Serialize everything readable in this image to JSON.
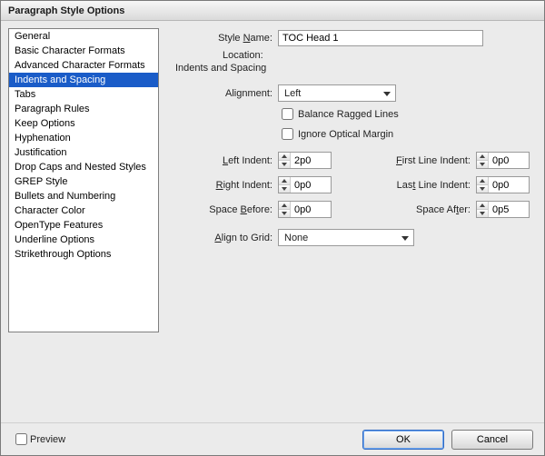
{
  "window": {
    "title": "Paragraph Style Options"
  },
  "sidebar": {
    "items": [
      "General",
      "Basic Character Formats",
      "Advanced Character Formats",
      "Indents and Spacing",
      "Tabs",
      "Paragraph Rules",
      "Keep Options",
      "Hyphenation",
      "Justification",
      "Drop Caps and Nested Styles",
      "GREP Style",
      "Bullets and Numbering",
      "Character Color",
      "OpenType Features",
      "Underline Options",
      "Strikethrough Options"
    ],
    "selected_index": 3
  },
  "header": {
    "style_name_label": "Style Name:",
    "style_name_value": "TOC Head 1",
    "location_label": "Location:",
    "section_title": "Indents and Spacing"
  },
  "fields": {
    "alignment_label": "Alignment:",
    "alignment_value": "Left",
    "balance_label": "Balance Ragged Lines",
    "ignore_label": "Ignore Optical Margin",
    "left_indent_label": "Left Indent:",
    "left_indent_value": "2p0",
    "right_indent_label": "Right Indent:",
    "right_indent_value": "0p0",
    "space_before_label": "Space Before:",
    "space_before_value": "0p0",
    "first_line_label": "First Line Indent:",
    "first_line_value": "0p0",
    "last_line_label": "Last Line Indent:",
    "last_line_value": "0p0",
    "space_after_label": "Space After:",
    "space_after_value": "0p5",
    "align_grid_label": "Align to Grid:",
    "align_grid_value": "None"
  },
  "footer": {
    "preview_label": "Preview",
    "ok_label": "OK",
    "cancel_label": "Cancel"
  }
}
